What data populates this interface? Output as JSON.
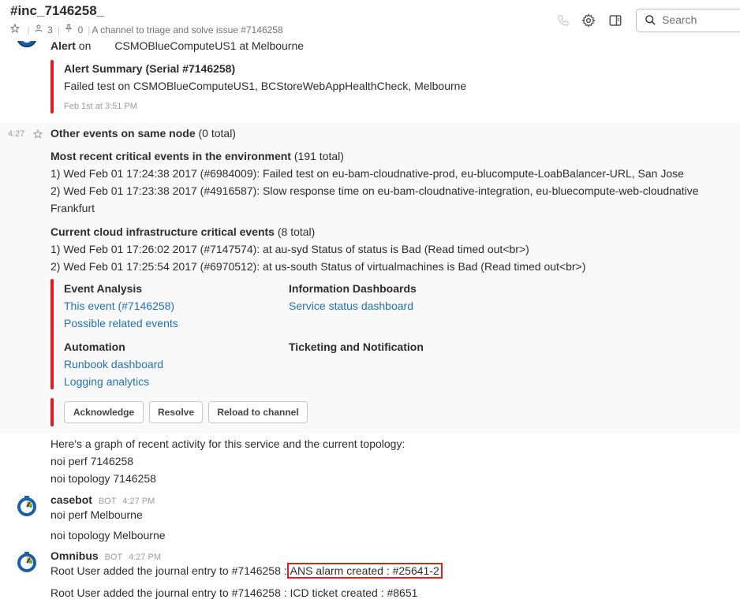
{
  "header": {
    "channel": "#inc_7146258_",
    "members": "3",
    "pins": "0",
    "purpose": "A channel to triage and solve issue #7146258",
    "search_placeholder": "Search"
  },
  "alert": {
    "top_label": "Alert",
    "top_on": "on",
    "top_rest": "CSMOBlueComputeUS1 at Melbourne",
    "summary_title": "Alert Summary (Serial #7146258)",
    "summary_text": "Failed test on CSMOBlueComputeUS1, BCStoreWebAppHealthCheck, Melbourne",
    "summary_time": "Feb 1st at 3:51 PM"
  },
  "events": {
    "time": "4:27",
    "other_title": "Other events on same node",
    "other_count": "(0 total)",
    "recent_title": "Most recent critical events in the environment",
    "recent_count": "(191 total)",
    "recent_1": "1) Wed Feb 01 17:24:38 2017 (#6984009): Failed test on eu-bam-cloudnative-prod, eu-blucompute-LoabBalancer-URL, San Jose",
    "recent_2": "2) Wed Feb 01 17:23:38 2017 (#4916587): Slow response time on eu-bam-cloudnative-integration, eu-bluecompute-web-cloudnative",
    "recent_2_cont": "Frankfurt",
    "cloud_title": "Current cloud infrastructure critical events",
    "cloud_count": "(8 total)",
    "cloud_1": "1) Wed Feb 01 17:26:02 2017 (#7147574): at au-syd Status of status is Bad (Read timed out<br>)",
    "cloud_2": "2) Wed Feb 01 17:25:54 2017 (#6970512): at us-south Status of virtualmachines is Bad (Read timed out<br>)"
  },
  "analysis": {
    "event_analysis": "Event Analysis",
    "this_event": "This event (#7146258)",
    "related_events": "Possible related events",
    "info_dash": "Information Dashboards",
    "service_status": "Service status dashboard",
    "automation": "Automation",
    "runbook": "Runbook dashboard",
    "logging": "Logging analytics",
    "ticketing": "Ticketing and Notification"
  },
  "actions": {
    "acknowledge": "Acknowledge",
    "resolve": "Resolve",
    "reload": "Reload to channel"
  },
  "messages": {
    "graph_intro": "Here's a graph of recent activity for this service and the current topology:",
    "perf": "noi perf 7146258",
    "topology": "noi topology 7146258",
    "casebot_name": "casebot",
    "casebot_badge": "BOT",
    "casebot_time": "4:27 PM",
    "casebot_1": "noi perf  Melbourne",
    "casebot_2": "noi topology  Melbourne",
    "omnibus_name": "Omnibus",
    "omnibus_badge": "BOT",
    "omnibus_time": "4:27 PM",
    "omnibus_1_prefix": "Root User added the journal entry to #7146258 :",
    "omnibus_1_highlight": "ANS alarm created : #25641-2",
    "omnibus_2": "Root User added the journal entry to #7146258 : ICD ticket created : #8651"
  },
  "colors": {
    "accent_bar": "#e01e1e",
    "link": "#1f73b7",
    "band": "#f9f9f9"
  }
}
